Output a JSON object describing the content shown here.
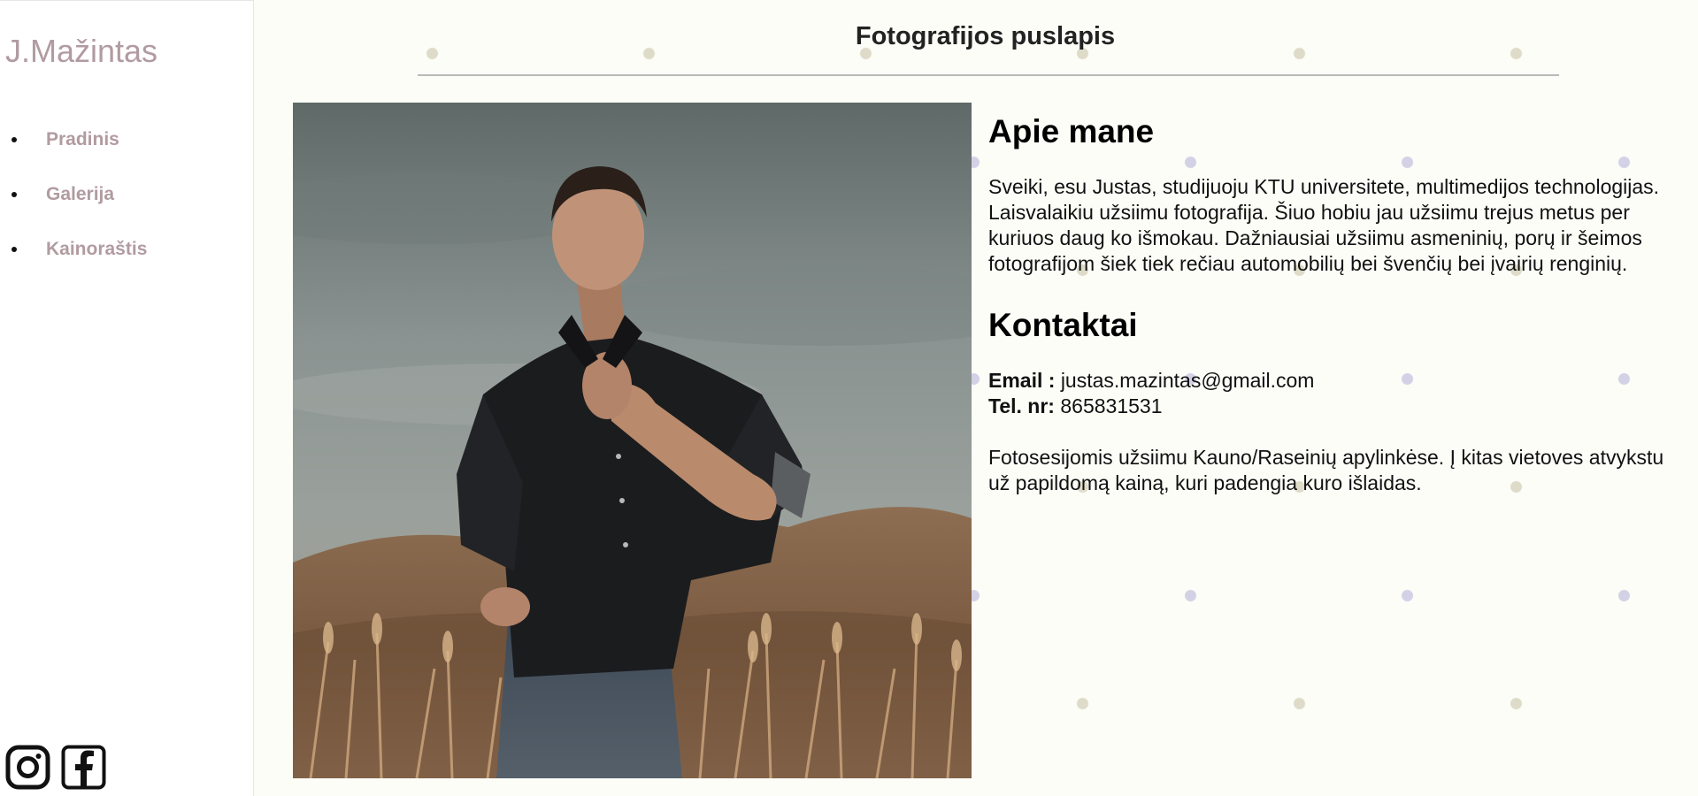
{
  "sidebar": {
    "logo": "J.Mažintas",
    "nav": [
      {
        "label": "Pradinis"
      },
      {
        "label": "Galerija"
      },
      {
        "label": "Kainoraštis"
      }
    ],
    "social": [
      {
        "icon": "instagram-icon"
      },
      {
        "icon": "facebook-icon"
      }
    ]
  },
  "header": {
    "title": "Fotografijos puslapis"
  },
  "about": {
    "heading": "Apie mane",
    "text": "Sveiki, esu Justas, studijuoju KTU universitete, multimedijos technologijas. Laisvalaikiu užsiimu fotografija. Šiuo hobiu jau užsiimu trejus metus per kuriuos daug ko išmokau. Dažniausiai užsiimu asmeninių, porų ir šeimos fotografijom šiek tiek rečiau automobilių bei švenčių bei įvairių renginių."
  },
  "contacts": {
    "heading": "Kontaktai",
    "email_label": "Email :",
    "email": "justas.mazintas@gmail.com",
    "phone_label": "Tel. nr:",
    "phone": "865831531",
    "note": "Fotosesijomis užsiimu Kauno/Raseinių apylinkėse. Į kitas vietoves atvykstu už papildomą kainą, kuri padengia kuro išlaidas."
  },
  "colors": {
    "accent": "#b19ba1",
    "background": "#fdfdf8",
    "dot_beige": "#dedcc9",
    "dot_lavender": "#d3d1e6"
  }
}
